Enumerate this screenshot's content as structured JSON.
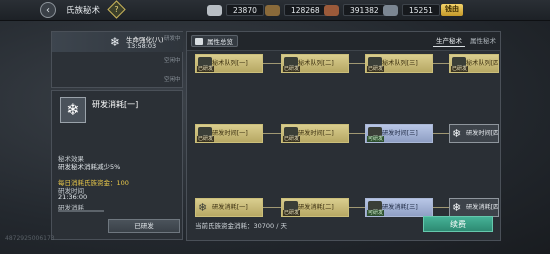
{
  "header": {
    "title": "氏族秘术",
    "back_icon": "back-arrow-icon",
    "help_icon": "help-diamond-icon",
    "resources": [
      {
        "icon": "silver-icon",
        "value": "23870",
        "color": "#b8bec4"
      },
      {
        "icon": "wood-icon",
        "value": "128268",
        "color": "#8a6a3a"
      },
      {
        "icon": "food-icon",
        "value": "391382",
        "color": "#9b5a3a"
      },
      {
        "icon": "iron-icon",
        "value": "15251",
        "color": "#7b8692"
      }
    ],
    "gold_button": "钱由"
  },
  "queue": {
    "active": {
      "name": "生命强化(八)",
      "time": "13:58:03",
      "icon": "snowflake-icon"
    },
    "slot_tags": [
      "研发中",
      "空闲中",
      "空闲中"
    ]
  },
  "detail": {
    "icon": "snowflake-icon",
    "name": "研发消耗[一]",
    "effect_label": "秘术效果",
    "effect_value": "研发秘术消耗减少5%",
    "daily_cost": "每日消耗氏族资金：100",
    "time_label": "研发时间",
    "time_value": "21:36:00",
    "cost_label": "研发消耗",
    "button": "已研发"
  },
  "watermark": "4872925006173",
  "tree": {
    "attr_button": "属性总览",
    "tabs": [
      "生产秘术",
      "属性秘术"
    ],
    "nodes": [
      {
        "label": "秘术队列[一]",
        "status": "已研发",
        "style": "gold"
      },
      {
        "label": "秘术队列[二]",
        "status": "已研发",
        "style": "gold"
      },
      {
        "label": "秘术队列[三]",
        "status": "已研发",
        "style": "gold"
      },
      {
        "label": "秘术队列[四]",
        "status": "已研发",
        "style": "gold"
      },
      {
        "label": "研发时间[一]",
        "status": "已研发",
        "style": "gold"
      },
      {
        "label": "研发时间[二]",
        "status": "已研发",
        "style": "gold"
      },
      {
        "label": "研发时间[三]",
        "status": "可研发",
        "style": "blue"
      },
      {
        "label": "研发时间[四]",
        "status": "",
        "style": "dark"
      },
      {
        "label": "研发消耗[一]",
        "status": "",
        "style": "gold"
      },
      {
        "label": "研发消耗[二]",
        "status": "已研发",
        "style": "gold"
      },
      {
        "label": "研发消耗[三]",
        "status": "可研发",
        "style": "blue"
      },
      {
        "label": "研发消耗[四]",
        "status": "",
        "style": "dark"
      }
    ],
    "footer": "当前氏族资金消耗：30700 / 天",
    "research_button": "续费"
  }
}
